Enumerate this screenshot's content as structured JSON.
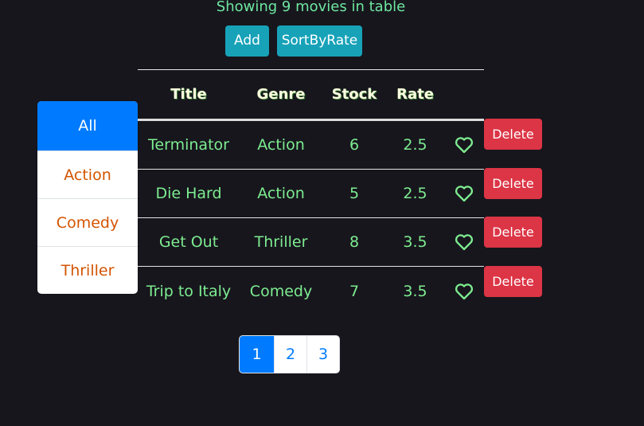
{
  "summary": "Showing 9 movies in table",
  "toolbar": {
    "add_label": "Add",
    "sort_label": "SortByRate"
  },
  "genres": [
    "All",
    "Action",
    "Comedy",
    "Thriller"
  ],
  "selected_genre": "All",
  "table": {
    "columns": [
      "Title",
      "Genre",
      "Stock",
      "Rate"
    ],
    "rows": [
      {
        "title": "Terminator",
        "genre": "Action",
        "stock": "6",
        "rate": "2.5",
        "delete": "Delete"
      },
      {
        "title": "Die Hard",
        "genre": "Action",
        "stock": "5",
        "rate": "2.5",
        "delete": "Delete"
      },
      {
        "title": "Get Out",
        "genre": "Thriller",
        "stock": "8",
        "rate": "3.5",
        "delete": "Delete"
      },
      {
        "title": "Trip to Italy",
        "genre": "Comedy",
        "stock": "7",
        "rate": "3.5",
        "delete": "Delete"
      }
    ]
  },
  "pagination": {
    "pages": [
      "1",
      "2",
      "3"
    ],
    "current": "1"
  },
  "colors": {
    "background": "#17161d",
    "text_green": "#7dec90",
    "accent_blue": "#007bff",
    "info": "#17a2b8",
    "danger": "#dc3545",
    "genre_text": "#d35400"
  },
  "icons": {
    "like": "heart-outline-icon"
  }
}
